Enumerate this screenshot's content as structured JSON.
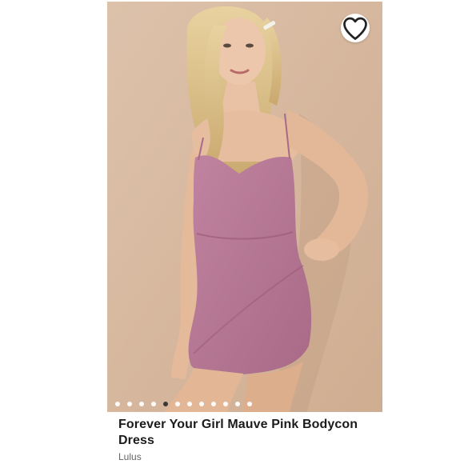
{
  "listing": {
    "title": "Forever Your Girl Mauve Pink Bodycon Dress",
    "brand": "Lulus",
    "image": {
      "subject": "model-in-mauve-pink-bodycon-dress",
      "carousel_total": 12,
      "carousel_active_index": 4
    },
    "like_icon": "heart-outline-icon"
  },
  "colors": {
    "dress": "#b97791",
    "background": "#d9baa0",
    "title_text": "#1b1b1b",
    "brand_text": "#666666"
  }
}
